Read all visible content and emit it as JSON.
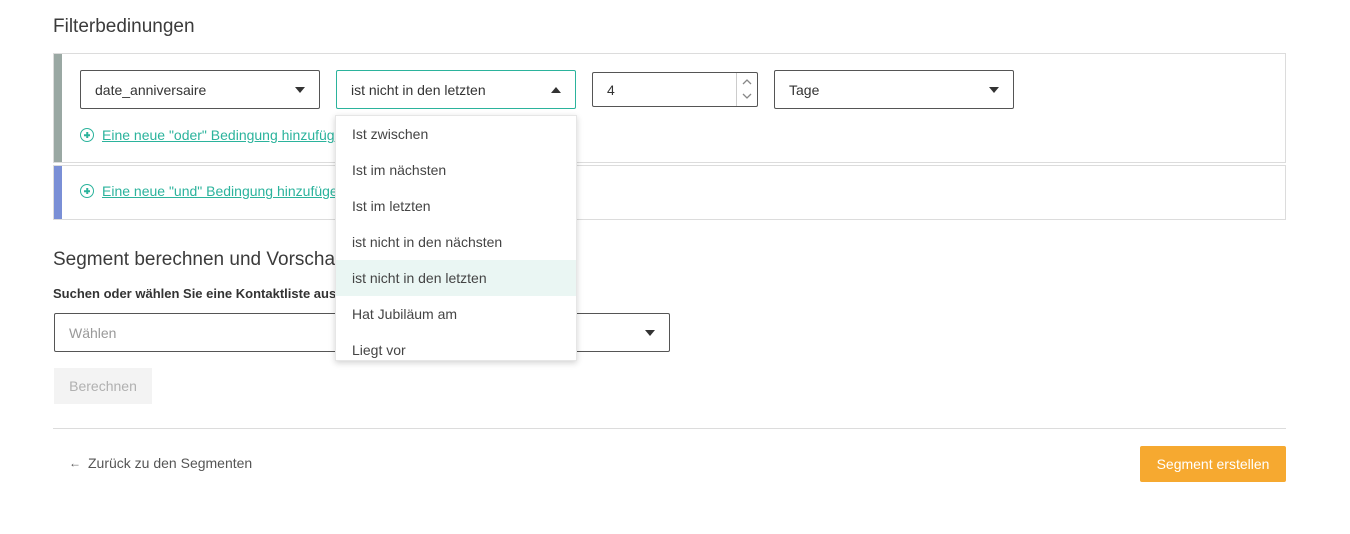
{
  "filter": {
    "heading": "Filterbedinungen",
    "attribute_select": "date_anniversaire",
    "operator_select": "ist nicht in den letzten",
    "number_value": "4",
    "unit_select": "Tage",
    "add_or_link": "Eine neue \"oder\" Bedingung hinzufügen",
    "add_and_link": "Eine neue \"und\" Bedingung hinzufügen",
    "or_bar_color": "#9aa8a3",
    "and_bar_color": "#7a8fd6"
  },
  "operator_dropdown": {
    "options": [
      "Ist zwischen",
      "Ist im nächsten",
      "Ist im letzten",
      "ist nicht in den nächsten",
      "ist nicht in den letzten",
      "Hat Jubiläum am",
      "Liegt vor"
    ],
    "selected_index": 4
  },
  "segment": {
    "heading": "Segment berechnen und Vorschau",
    "description": "Suchen oder wählen Sie eine Kontaktliste aus, um eine Vorschau zu erhalten",
    "list_placeholder": "Wählen",
    "compute_button": "Berechnen"
  },
  "footer": {
    "back_link": "Zurück zu den Segmenten",
    "create_button": "Segment erstellen"
  },
  "colors": {
    "accent": "#2bb39c",
    "primary_button": "#f6a930"
  }
}
